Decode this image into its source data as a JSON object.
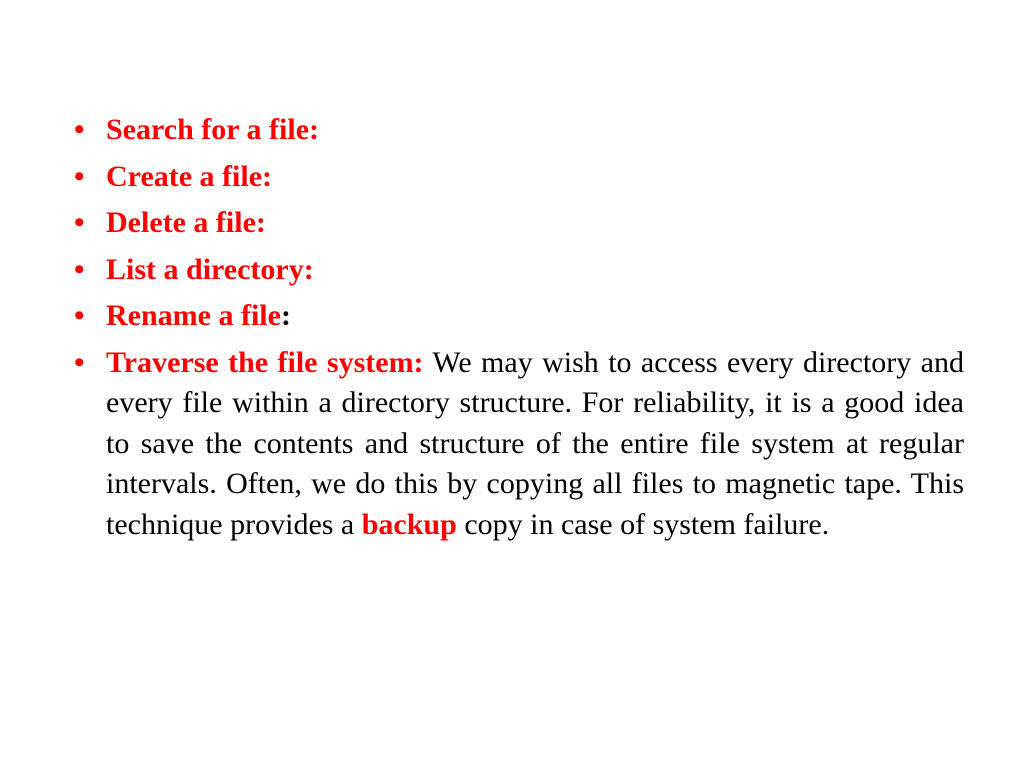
{
  "bullets": {
    "b1": "Search for a file:",
    "b2": "Create a file:",
    "b3": "Delete a file:",
    "b4": "List a directory:",
    "b5_red": "Rename a file",
    "b5_colon": ":",
    "b6_head": "Traverse the file system:",
    "b6_body_1": " We may wish to access every directory and every file within a directory structure. For reliability, it is a good idea to save the contents and structure of the entire file system at regular intervals. Often, we do this by copying all files to magnetic tape. This technique provides a ",
    "b6_backup": "backup",
    "b6_body_2": " copy in case of system failure."
  }
}
